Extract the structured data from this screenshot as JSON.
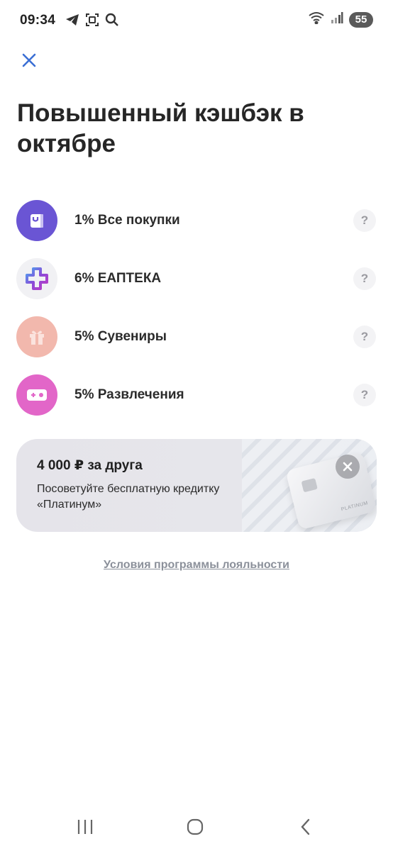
{
  "status_bar": {
    "time": "09:34",
    "battery": "55",
    "icons_left": [
      "telegram-icon",
      "scan-icon",
      "search-icon"
    ],
    "icons_right": [
      "wifi-icon",
      "signal-icon",
      "battery-icon"
    ]
  },
  "header": {
    "title": "Повышенный кэшбэк в октябре"
  },
  "categories": [
    {
      "label": "1% Все покупки",
      "icon": "shopping-bag-icon",
      "color": "#6a55d4"
    },
    {
      "label": "6% ЕАПТЕКА",
      "icon": "pharmacy-cross-icon",
      "color": "#f1f1f4"
    },
    {
      "label": "5% Сувениры",
      "icon": "gift-icon",
      "color": "#f2b8ad"
    },
    {
      "label": "5% Развлечения",
      "icon": "gamepad-icon",
      "color": "#e266c8"
    }
  ],
  "help_label": "?",
  "promo": {
    "title": "4 000 ₽ за друга",
    "text": "Посоветуйте бесплатную кредитку «Платинум»",
    "card_text": "PLATINUM"
  },
  "terms_link": "Условия программы лояльности",
  "colors": {
    "accent": "#3b6fd4",
    "title": "#262626",
    "link": "#8b909a"
  }
}
